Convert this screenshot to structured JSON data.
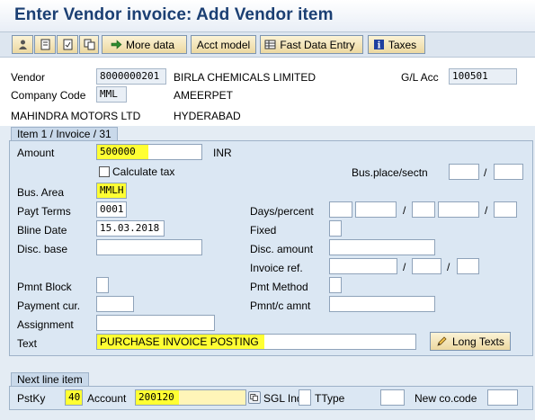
{
  "window": {
    "title": "Enter Vendor invoice: Add Vendor item"
  },
  "toolbar": {
    "more_data": "More data",
    "acct_model": "Acct model",
    "fast_data_entry": "Fast Data Entry",
    "taxes": "Taxes"
  },
  "header": {
    "vendor_label": "Vendor",
    "vendor_value": "8000000201",
    "vendor_name": "BIRLA CHEMICALS LIMITED",
    "gl_acc_label": "G/L Acc",
    "gl_acc_value": "100501",
    "company_code_label": "Company Code",
    "company_code_value": "MML",
    "city": "AMEERPET",
    "company_name": "MAHINDRA MOTORS LTD",
    "region": "HYDERABAD"
  },
  "item": {
    "tab_title": "Item 1 / Invoice / 31",
    "amount_label": "Amount",
    "amount_value": "500000",
    "currency": "INR",
    "calculate_tax_label": "Calculate tax",
    "bus_place_label": "Bus.place/sectn",
    "slash": "/",
    "bus_area_label": "Bus. Area",
    "bus_area_value": "MMLH",
    "payt_terms_label": "Payt Terms",
    "payt_terms_value": "0001",
    "days_percent_label": "Days/percent",
    "bline_date_label": "Bline Date",
    "bline_date_value": "15.03.2018",
    "fixed_label": "Fixed",
    "disc_base_label": "Disc. base",
    "disc_amount_label": "Disc. amount",
    "invoice_ref_label": "Invoice ref.",
    "pmnt_block_label": "Pmnt Block",
    "pmt_method_label": "Pmt Method",
    "payment_cur_label": "Payment cur.",
    "pmnt_c_amnt_label": "Pmnt/c amnt",
    "assignment_label": "Assignment",
    "text_label": "Text",
    "text_value": "PURCHASE INVOICE POSTING",
    "long_texts": "Long Texts"
  },
  "next_line": {
    "tab_title": "Next line item",
    "pstky_label": "PstKy",
    "pstky_value": "40",
    "account_label": "Account",
    "account_value": "200120",
    "gl_ind_label": "SGL Ind",
    "ttype_label": "TType",
    "new_co_code_label": "New co.code"
  },
  "colors": {
    "highlight": "#ffff33",
    "title": "#1b3f73",
    "panel": "#dbe7f3"
  }
}
